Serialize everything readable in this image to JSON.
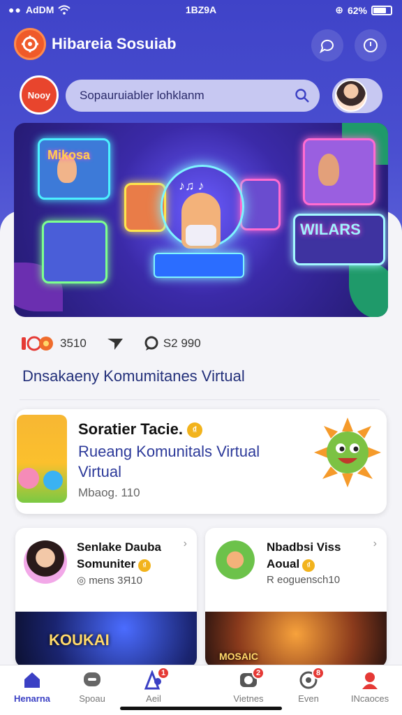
{
  "status_bar": {
    "carrier": "AdDM",
    "time": "1BZ9A",
    "battery": "62%"
  },
  "header": {
    "title": "Hibareia Sosuiab"
  },
  "search": {
    "now_label": "Nooy",
    "placeholder": "Sopauruiabler lohklanm"
  },
  "hero": {
    "tag_left": "Mikosa",
    "tag_right": "WILARS",
    "notes": "♪♫ ♪"
  },
  "stats": {
    "likes": "3510",
    "comments": "S2 990"
  },
  "section_heading": "Dnsakaeny Komumitanes Virtual",
  "featured": {
    "title": "Soratier Tacie.",
    "badge": "₫",
    "subtitle": "Rueang Komunitals Virtual Virtual",
    "meta": "Mbaog. 110"
  },
  "cards": [
    {
      "title_line1": "Senlake Dauba",
      "title_line2": "Somuniter",
      "meta": "◎ mens 3Я10",
      "banner": "KOUKAI"
    },
    {
      "title_line1": "Nbadbsi Viss",
      "title_line2": "Aoual",
      "meta": "R eoguensch10",
      "banner": "MOSAIC"
    }
  ],
  "tabs": [
    {
      "label": "Henarna",
      "icon": "home-icon",
      "badge": ""
    },
    {
      "label": "Spoau",
      "icon": "chat-icon",
      "badge": ""
    },
    {
      "label": "Aeil",
      "icon": "people-icon",
      "badge": "1"
    },
    {
      "label": "Vietnes",
      "icon": "video-icon",
      "badge": "2"
    },
    {
      "label": "Even",
      "icon": "event-icon",
      "badge": "8"
    },
    {
      "label": "INcaoces",
      "icon": "profile-icon",
      "badge": ""
    }
  ],
  "colors": {
    "primary": "#3f43c8",
    "accent": "#e8452d",
    "badge": "#e53935"
  }
}
